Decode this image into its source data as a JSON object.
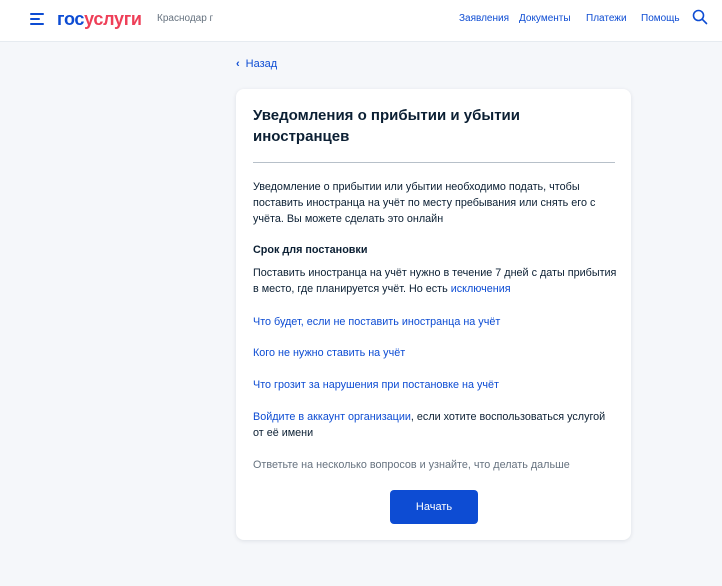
{
  "header": {
    "logo_part1": "гос",
    "logo_part2": "услуги",
    "city": "Краснодар г",
    "nav": [
      "Заявления",
      "Документы",
      "Платежи",
      "Помощь"
    ],
    "icons": {
      "menu": "burger-menu-icon",
      "search": "search-icon"
    }
  },
  "back_label": "Назад",
  "card": {
    "title": "Уведомления о прибытии и убытии иностранцев",
    "intro": "Уведомление о прибытии или убытии необходимо подать, чтобы поставить иностранца на учёт по месту пребывания или снять его с учёта. Вы можете сделать это онлайн",
    "deadline_heading": "Срок для постановки",
    "deadline_text": "Поставить иностранца на учёт нужно в течение 7 дней с даты прибытия в место, где планируется учёт. Но есть ",
    "deadline_link": "исключения",
    "link1": "Что будет, если не поставить иностранца на учёт",
    "link2": "Кого не нужно ставить на учёт",
    "link3": "Что грозит за нарушения при постановке на учёт",
    "org_link": "Войдите в аккаунт организации",
    "org_text": ", если хотите воспользоваться услугой от её имени",
    "questions_text": "Ответьте на несколько вопросов и узнайте, что делать дальше",
    "start_button": "Начать"
  },
  "colors": {
    "brand_blue": "#0d4cd3",
    "brand_red": "#ee3f58",
    "background": "#f5f7fa",
    "text": "#0b1f33",
    "muted": "#66727f"
  }
}
